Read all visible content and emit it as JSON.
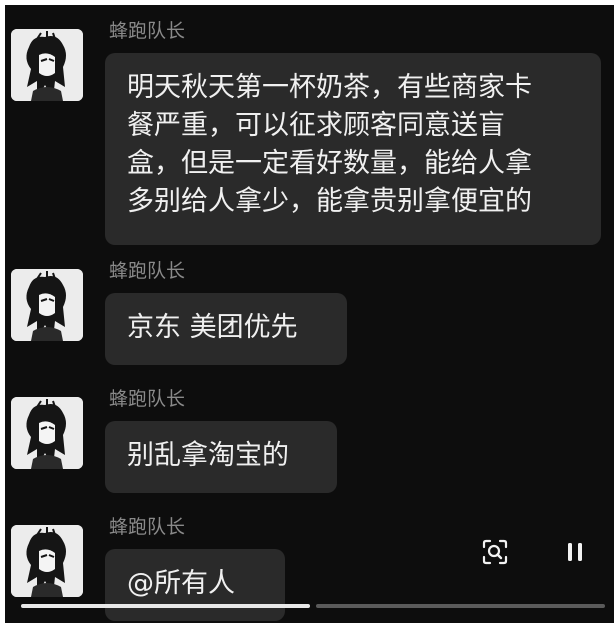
{
  "chat": {
    "messages": [
      {
        "sender": "蜂跑队长",
        "lines": [
          "明天秋天第一杯奶茶，有些商家卡",
          "餐严重，可以征求顾客同意送盲",
          "盒，但是一定看好数量，能给人拿",
          "多别给人拿少，能拿贵别拿便宜的"
        ]
      },
      {
        "sender": "蜂跑队长",
        "lines": [
          "京东 美团优先"
        ]
      },
      {
        "sender": "蜂跑队长",
        "lines": [
          "别乱拿淘宝的"
        ]
      },
      {
        "sender": "蜂跑队长",
        "lines": [
          "@所有人"
        ]
      }
    ]
  },
  "controls": {
    "search_icon": "lens-search-icon",
    "pause_icon": "pause-icon"
  },
  "progress": {
    "segments": 2,
    "active_index": 0
  },
  "colors": {
    "background": "#0d0d0d",
    "bubble": "#2a2a2a",
    "bubble_text": "#f0f0f0",
    "sender_text": "#8a8a8a"
  }
}
